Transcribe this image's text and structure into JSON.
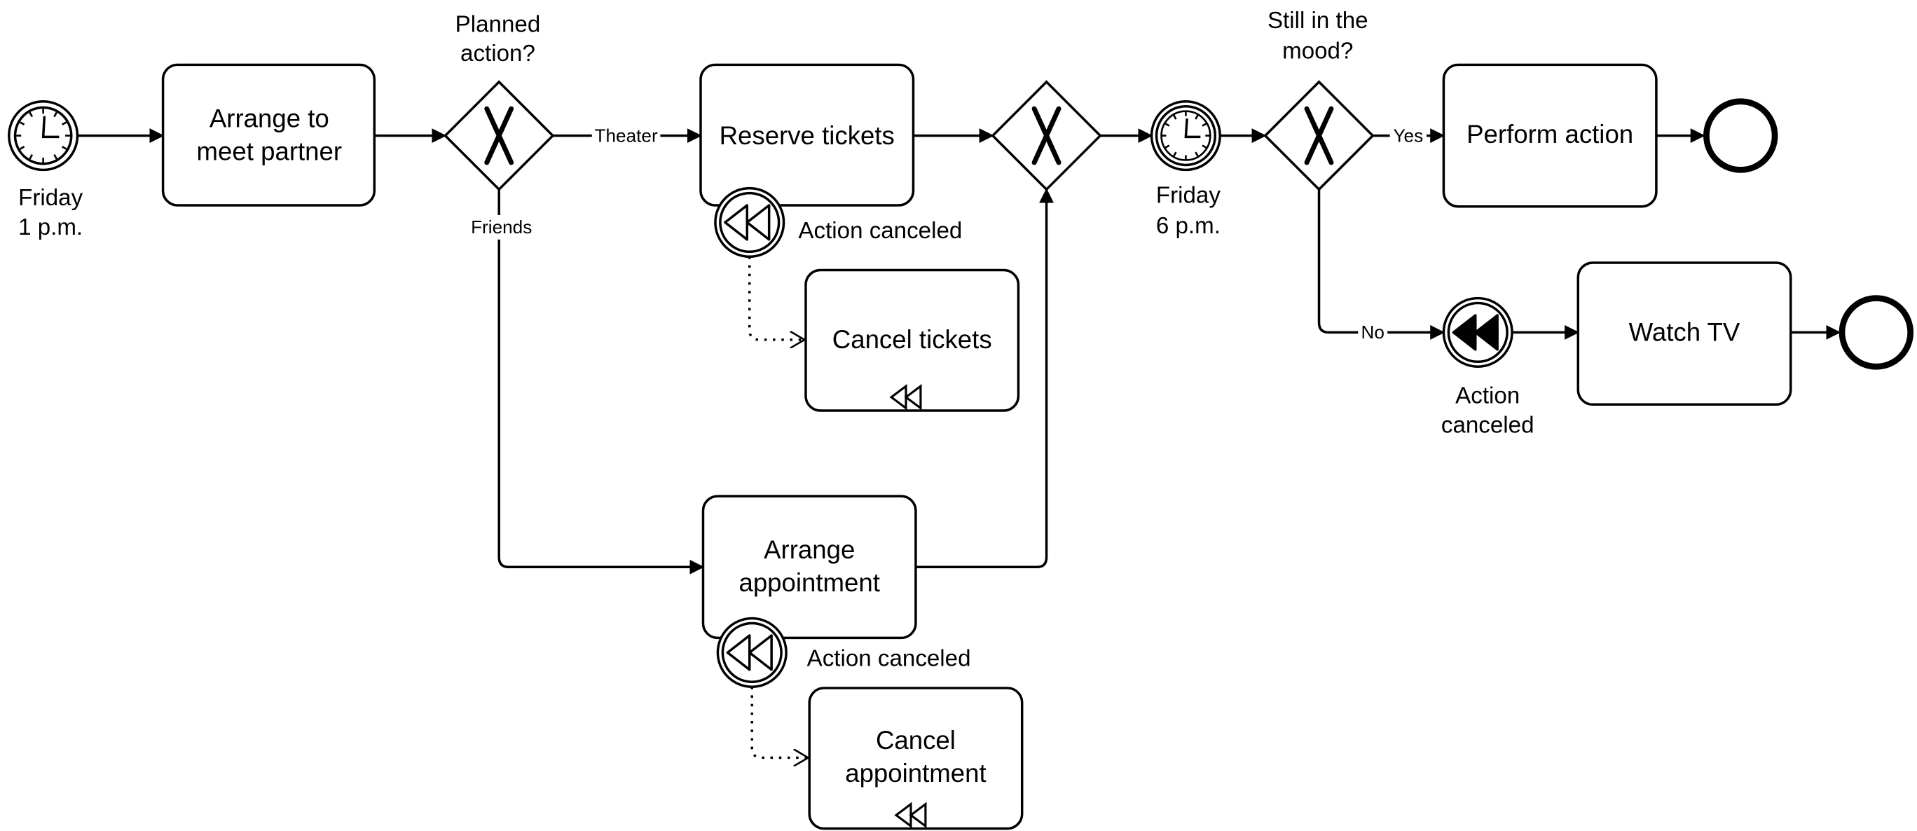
{
  "diagram": {
    "start_event": {
      "label_line1": "Friday",
      "label_line2": "1 p.m.",
      "icon": "clock-icon"
    },
    "tasks": {
      "arrange_meet": {
        "line1": "Arrange to",
        "line2": "meet partner"
      },
      "reserve_tickets": {
        "label": "Reserve tickets"
      },
      "cancel_tickets": {
        "label": "Cancel tickets",
        "marker": "compensation-icon"
      },
      "arrange_appointment": {
        "line1": "Arrange",
        "line2": "appointment"
      },
      "cancel_appointment": {
        "line1": "Cancel",
        "line2": "appointment",
        "marker": "compensation-icon"
      },
      "perform_action": {
        "label": "Perform action"
      },
      "watch_tv": {
        "label": "Watch TV"
      }
    },
    "gateways": {
      "planned": {
        "line1": "Planned",
        "line2": "action?",
        "type": "exclusive"
      },
      "merge": {
        "type": "exclusive"
      },
      "mood": {
        "line1": "Still in the",
        "line2": "mood?",
        "type": "exclusive"
      }
    },
    "flow_labels": {
      "theater": "Theater",
      "friends": "Friends",
      "yes": "Yes",
      "no": "No"
    },
    "boundary_events": {
      "reserve": {
        "label": "Action canceled",
        "icon": "compensation-icon"
      },
      "appointment": {
        "label": "Action canceled",
        "icon": "compensation-icon"
      }
    },
    "timer_event": {
      "label_line1": "Friday",
      "label_line2": "6 p.m.",
      "icon": "clock-icon"
    },
    "throw_event": {
      "label_line1": "Action",
      "label_line2": "canceled",
      "icon": "compensation-filled-icon"
    }
  }
}
